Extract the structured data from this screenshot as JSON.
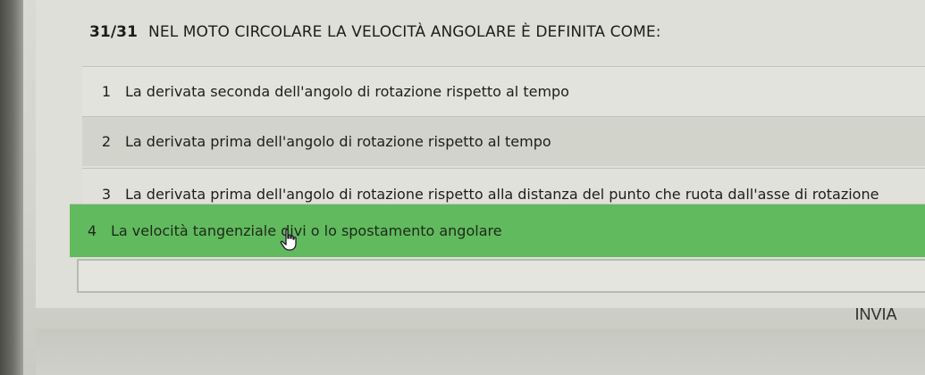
{
  "question": {
    "counter": "31/31",
    "text": "NEL MOTO CIRCOLARE LA VELOCITÀ ANGOLARE È DEFINITA COME:"
  },
  "options": [
    {
      "index": "1",
      "label": "La derivata seconda dell'angolo di rotazione rispetto al tempo"
    },
    {
      "index": "2",
      "label": "La derivata prima dell'angolo di rotazione rispetto al tempo"
    },
    {
      "index": "3",
      "label": "La derivata prima dell'angolo di rotazione rispetto alla distanza del punto che ruota dall'asse di rotazione"
    },
    {
      "index": "4",
      "label": "La velocità tangenziale divi   o lo spostamento angolare"
    }
  ],
  "selected_option": "4",
  "answer_input": {
    "value": ""
  },
  "submit_label": "INVIA",
  "colors": {
    "selected_highlight": "#62ba5e",
    "background": "#d9dad3"
  },
  "icons": {
    "cursor": "hand-pointer-icon"
  }
}
